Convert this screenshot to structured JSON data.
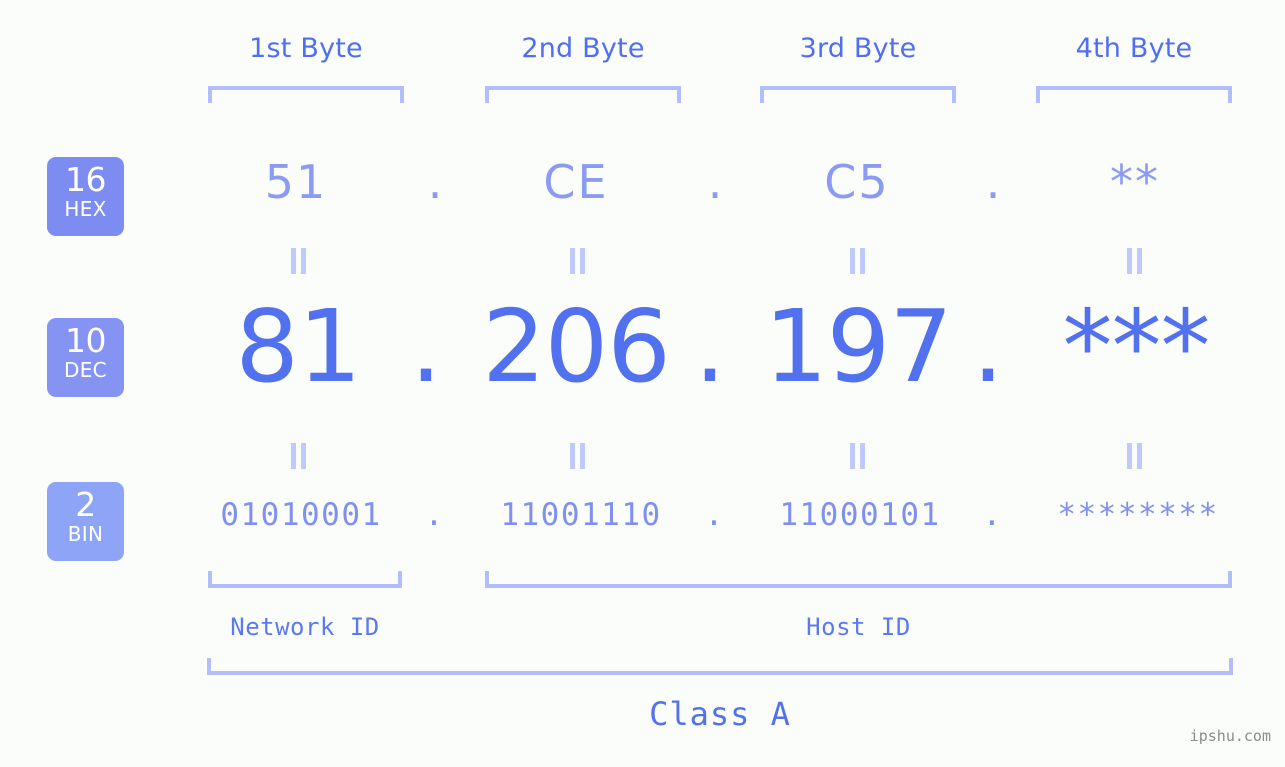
{
  "meta": {
    "background_color": "#fbfdfa",
    "accent_strong": "#5271ee",
    "accent_mid": "#8b9bf3",
    "accent_light": "#b3bdfb",
    "watermark": "ipshu.com"
  },
  "byte_headers": [
    {
      "label": "1st Byte"
    },
    {
      "label": "2nd Byte"
    },
    {
      "label": "3rd Byte"
    },
    {
      "label": "4th Byte"
    }
  ],
  "bases": [
    {
      "number": "16",
      "unit": "HEX",
      "color": "#7d8cf0"
    },
    {
      "number": "10",
      "unit": "DEC",
      "color": "#8593f2"
    },
    {
      "number": "2",
      "unit": "BIN",
      "color": "#8ea4f7"
    }
  ],
  "rows": {
    "hex": {
      "base_number": "16",
      "base_unit": "HEX",
      "values": [
        "51",
        "CE",
        "C5",
        "**"
      ],
      "separators": [
        ".",
        ".",
        "."
      ]
    },
    "dec": {
      "base_number": "10",
      "base_unit": "DEC",
      "values": [
        "81",
        "206",
        "197",
        "***"
      ],
      "separators": [
        ".",
        ".",
        "."
      ]
    },
    "bin": {
      "base_number": "2",
      "base_unit": "BIN",
      "values": [
        "01010001",
        "11001110",
        "11000101",
        "********"
      ],
      "separators": [
        ".",
        ".",
        "."
      ]
    }
  },
  "equals_marks": {
    "glyph": "||",
    "count_per_gap": 4
  },
  "id_sections": [
    {
      "label": "Network ID"
    },
    {
      "label": "Host ID"
    }
  ],
  "class": {
    "label": "Class A"
  }
}
